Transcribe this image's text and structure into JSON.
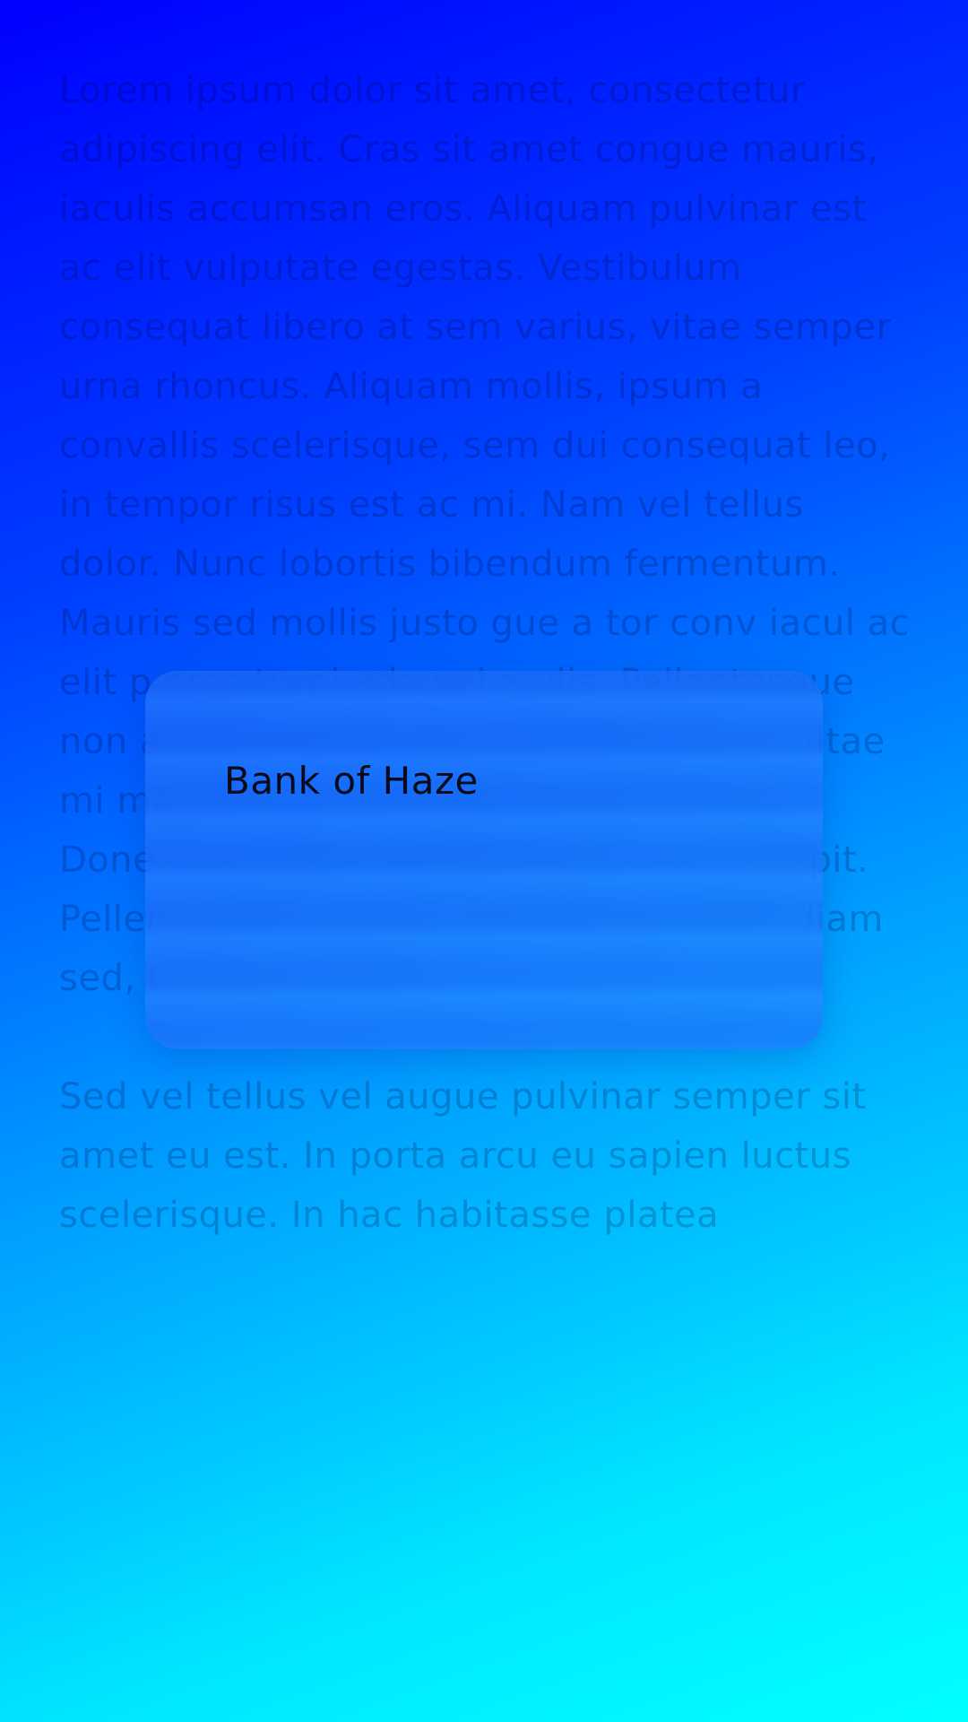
{
  "background_text": {
    "paragraph_1": "Lorem ipsum dolor sit amet, consectetur adipiscing elit. Cras sit amet congue mauris, iaculis accumsan eros. Aliquam pulvinar est ac elit vulputate egestas. Vestibulum consequat libero at sem varius, vitae semper urna rhoncus. Aliquam mollis, ipsum a convallis scelerisque, sem dui consequat leo, in tempor risus est ac mi. Nam vel tellus dolor. Nunc lobortis bibendum fermentum. Mauris sed mollis justo gue a tor conv iacul ac elit p eros turpi ada vel a ulis. Pellentesque non augue magna. Mauris mattis purus vitae mi maximus, id molestie ipsum facilisis. Donec bibendum gravida dolor nec suscipit. Pellentesque tempus felis iaculis, porta diam sed, tristique tortor.",
    "paragraph_2": "Sed vel tellus vel augue pulvinar semper sit amet eu est. In porta arcu eu sapien luctus scelerisque. In hac habitasse platea"
  },
  "card": {
    "title": "Bank of Haze"
  },
  "colors": {
    "gradient_start": "#0000ff",
    "gradient_end": "#00ffff",
    "card_tint": "#2878ff",
    "title_color": "#0a0a1a"
  }
}
